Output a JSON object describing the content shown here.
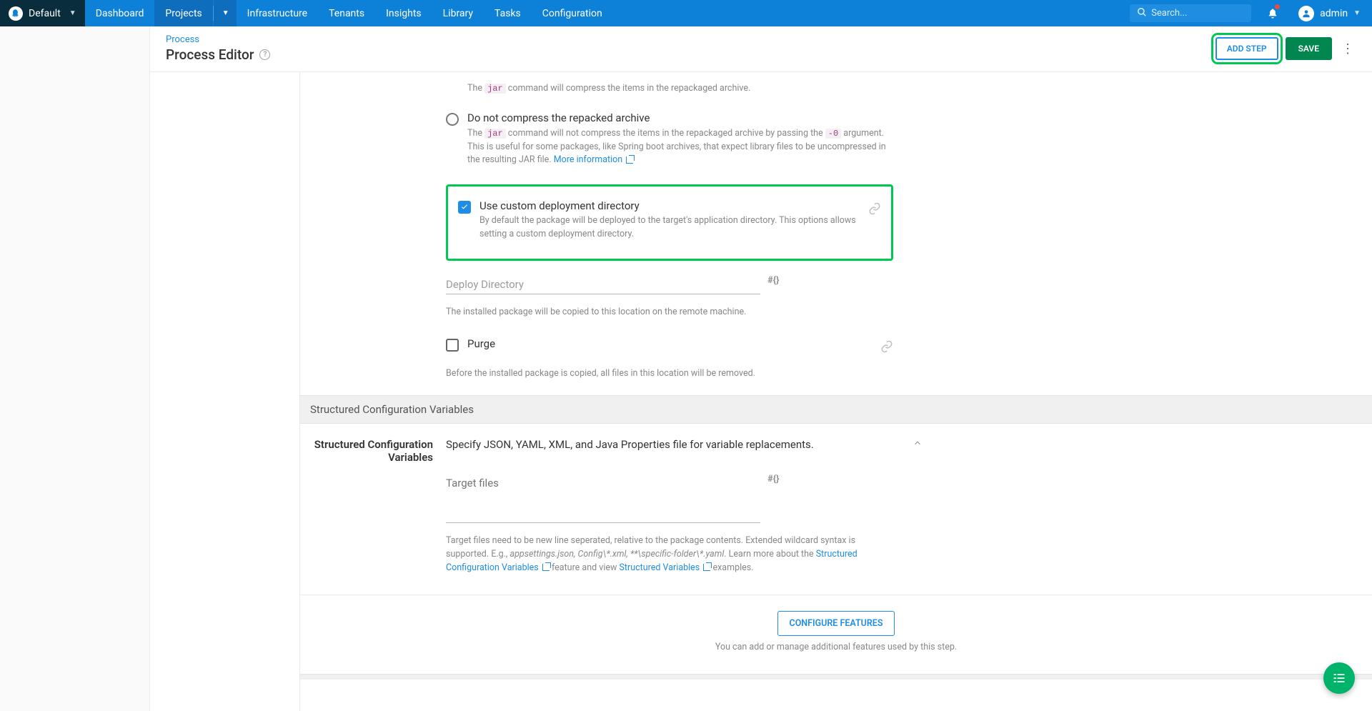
{
  "topnav": {
    "space_name": "Default",
    "items": [
      "Dashboard",
      "Projects",
      "Infrastructure",
      "Tenants",
      "Insights",
      "Library",
      "Tasks",
      "Configuration"
    ],
    "active_index": 1,
    "search_placeholder": "Search...",
    "username": "admin"
  },
  "header": {
    "breadcrumb": "Process",
    "title": "Process Editor",
    "add_step_label": "ADD STEP",
    "save_label": "SAVE"
  },
  "deployment": {
    "compress_desc_prefix": "The ",
    "compress_code": "jar",
    "compress_desc_suffix": " command will compress the items in the repackaged archive.",
    "no_compress_title": "Do not compress the repacked archive",
    "no_compress_desc_1": "The ",
    "no_compress_code1": "jar",
    "no_compress_desc_2": " command will not compress the items in the repackaged archive by passing the ",
    "no_compress_code2": "-0",
    "no_compress_desc_3": " argument. This is useful for some packages, like Spring boot archives, that expect library files to be uncompressed in the resulting JAR file. ",
    "more_info": "More information",
    "use_custom_title": "Use custom deployment directory",
    "use_custom_desc": "By default the package will be deployed to the target's application directory. This options allows setting a custom deployment directory.",
    "deploy_dir_placeholder": "Deploy Directory",
    "deploy_dir_help": "The installed package will be copied to this location on the remote machine.",
    "purge_title": "Purge",
    "purge_help": "Before the installed package is copied, all files in this location will be removed.",
    "bind_badge": "#{}"
  },
  "section_scv": "Structured Configuration Variables",
  "scv": {
    "label": "Structured Configuration Variables",
    "intro": "Specify JSON, YAML, XML, and Java Properties file for variable replacements.",
    "target_placeholder": "Target files",
    "help_1": "Target files need to be new line seperated, relative to the package contents. Extended wildcard syntax is supported. E.g., ",
    "help_examples": "appsettings.json, Config\\*.xml, **\\specific-folder\\*.yaml",
    "help_2": ". Learn more about the ",
    "link1": "Structured Configuration Variables",
    "help_3": " feature and view ",
    "link2": "Structured Variables",
    "help_4": " examples."
  },
  "configure": {
    "btn": "CONFIGURE FEATURES",
    "sub": "You can add or manage additional features used by this step."
  }
}
